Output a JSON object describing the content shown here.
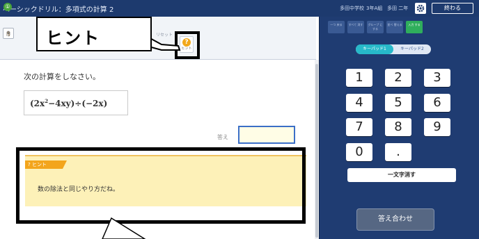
{
  "header": {
    "title": "ベーシックドリル：多項式の計算 2",
    "school": "多田中学校",
    "class": "3年A組",
    "student": "多田 二年",
    "end_label": "終わる"
  },
  "toolbar": {
    "step_number": "①",
    "hint_button_label": "ヒント",
    "faint_label": "リセット"
  },
  "callout": {
    "text": "ヒント"
  },
  "problem": {
    "instruction": "次の計算をしなさい。",
    "formula_left": "(2x",
    "formula_exp": "2",
    "formula_right": "−4xy)÷(−2x)",
    "answer_label": "答え"
  },
  "hint": {
    "tag": "? ヒント",
    "text": "数の除法と同じやり方だね。"
  },
  "keypad": {
    "tabs": [
      {
        "label": "一つ 戻る"
      },
      {
        "label": "すべて 消す"
      },
      {
        "label": "グループ にする"
      },
      {
        "label": "並べ 替える"
      },
      {
        "label": "入力 する"
      }
    ],
    "mode_on": "キーパッド1",
    "mode_off": "キーパッド2",
    "keys": [
      "1",
      "2",
      "3",
      "4",
      "5",
      "6",
      "7",
      "8",
      "9",
      "0",
      "."
    ],
    "delete_label": "一文字消す",
    "submit_label": "答え合わせ"
  },
  "colors": {
    "navy": "#1d3a6e",
    "hint_yellow": "#fdf1b8",
    "hint_orange": "#f3a51c",
    "active_green": "#2fae5c",
    "toggle_cyan": "#27b9c9"
  }
}
